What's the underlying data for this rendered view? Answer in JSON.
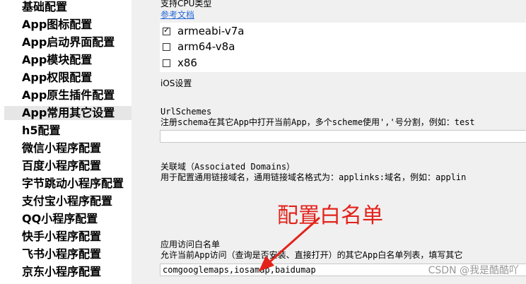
{
  "sidebar": {
    "items": [
      {
        "label": "基础配置",
        "selected": false
      },
      {
        "label": "App图标配置",
        "selected": false
      },
      {
        "label": "App启动界面配置",
        "selected": false
      },
      {
        "label": "App模块配置",
        "selected": false
      },
      {
        "label": "App权限配置",
        "selected": false
      },
      {
        "label": "App原生插件配置",
        "selected": false
      },
      {
        "label": "App常用其它设置",
        "selected": true
      },
      {
        "label": "h5配置",
        "selected": false
      },
      {
        "label": "微信小程序配置",
        "selected": false
      },
      {
        "label": "百度小程序配置",
        "selected": false
      },
      {
        "label": "字节跳动小程序配置",
        "selected": false
      },
      {
        "label": "支付宝小程序配置",
        "selected": false
      },
      {
        "label": "QQ小程序配置",
        "selected": false
      },
      {
        "label": "快手小程序配置",
        "selected": false
      },
      {
        "label": "飞书小程序配置",
        "selected": false
      },
      {
        "label": "京东小程序配置",
        "selected": false
      }
    ]
  },
  "content": {
    "cpu_section_title": "支持CPU类型",
    "reference_link": "参考文档",
    "cpu_options": [
      {
        "label": "armeabi-v7a",
        "checked": true
      },
      {
        "label": "arm64-v8a",
        "checked": false
      },
      {
        "label": "x86",
        "checked": false
      }
    ],
    "ios_settings_title": "iOS设置",
    "url_schemes_title": "UrlSchemes",
    "url_schemes_desc": "注册schema在其它App中打开当前App，多个scheme使用','号分割，例如：test",
    "url_schemes_value": "",
    "associated_domains_title": "关联域（Associated Domains）",
    "associated_domains_desc": "用于配置通用链接域名，通用链接域名格式为：applinks:域名，例如：applin",
    "whitelist_title": "应用访问白名单",
    "whitelist_desc": "允许当前App访问（查询是否安装、直接打开）的其它App白名单列表，填写其它",
    "whitelist_value": "comgooglemaps,iosamap,baidumap"
  },
  "annotation": {
    "text": "配置白名单",
    "color": "#e3221b"
  },
  "watermark": "CSDN @我是酷酷吖"
}
